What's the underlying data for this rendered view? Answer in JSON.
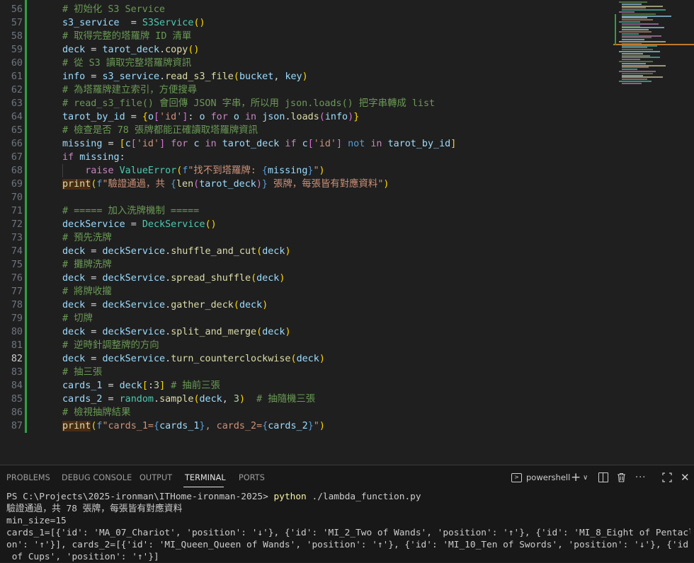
{
  "editor": {
    "active_line": "82",
    "lines": [
      {
        "num": "56",
        "segs": [
          [
            "# 初始化 S3 Service",
            "cm"
          ]
        ]
      },
      {
        "num": "57",
        "segs": [
          [
            "s3_service",
            "v"
          ],
          [
            "  = ",
            "p"
          ],
          [
            "S3Service",
            "cls"
          ],
          [
            "()",
            "br1"
          ]
        ]
      },
      {
        "num": "58",
        "segs": [
          [
            "# 取得完整的塔羅牌 ID 清單",
            "cm"
          ]
        ]
      },
      {
        "num": "59",
        "segs": [
          [
            "deck",
            "v"
          ],
          [
            " = ",
            "p"
          ],
          [
            "tarot_deck",
            "v"
          ],
          [
            ".",
            "p"
          ],
          [
            "copy",
            "fn"
          ],
          [
            "()",
            "br1"
          ]
        ]
      },
      {
        "num": "60",
        "segs": [
          [
            "# 從 S3 讀取完整塔羅牌資訊",
            "cm"
          ]
        ]
      },
      {
        "num": "61",
        "segs": [
          [
            "info",
            "v"
          ],
          [
            " = ",
            "p"
          ],
          [
            "s3_service",
            "v"
          ],
          [
            ".",
            "p"
          ],
          [
            "read_s3_file",
            "fn"
          ],
          [
            "(",
            "br1"
          ],
          [
            "bucket",
            "v"
          ],
          [
            ", ",
            "p"
          ],
          [
            "key",
            "v"
          ],
          [
            ")",
            "br1"
          ]
        ]
      },
      {
        "num": "62",
        "segs": [
          [
            "# 為塔羅牌建立索引，方便搜尋",
            "cm"
          ]
        ]
      },
      {
        "num": "63",
        "segs": [
          [
            "# read_s3_file() 會回傳 JSON 字串，所以用 json.loads() 把字串轉成 list",
            "cm"
          ]
        ]
      },
      {
        "num": "64",
        "segs": [
          [
            "tarot_by_id",
            "v"
          ],
          [
            " = ",
            "p"
          ],
          [
            "{",
            "br1"
          ],
          [
            "o",
            "v"
          ],
          [
            "[",
            "br2"
          ],
          [
            "'id'",
            "s"
          ],
          [
            "]",
            "br2"
          ],
          [
            ": ",
            "p"
          ],
          [
            "o",
            "v"
          ],
          [
            " for ",
            "kw"
          ],
          [
            "o",
            "v"
          ],
          [
            " in ",
            "kw"
          ],
          [
            "json",
            "v"
          ],
          [
            ".",
            "p"
          ],
          [
            "loads",
            "fn"
          ],
          [
            "(",
            "br2"
          ],
          [
            "info",
            "v"
          ],
          [
            ")",
            "br2"
          ],
          [
            "}",
            "br1"
          ]
        ]
      },
      {
        "num": "65",
        "segs": [
          [
            "# 檢查是否 78 張牌都能正確讀取塔羅牌資訊",
            "cm"
          ]
        ]
      },
      {
        "num": "66",
        "segs": [
          [
            "missing",
            "v"
          ],
          [
            " = ",
            "p"
          ],
          [
            "[",
            "br1"
          ],
          [
            "c",
            "v"
          ],
          [
            "[",
            "br2"
          ],
          [
            "'id'",
            "s"
          ],
          [
            "]",
            "br2"
          ],
          [
            " for ",
            "kw"
          ],
          [
            "c",
            "v"
          ],
          [
            " in ",
            "kw"
          ],
          [
            "tarot_deck",
            "v"
          ],
          [
            " if ",
            "kw"
          ],
          [
            "c",
            "v"
          ],
          [
            "[",
            "br2"
          ],
          [
            "'id'",
            "s"
          ],
          [
            "]",
            "br2"
          ],
          [
            " not ",
            "bl"
          ],
          [
            "in",
            "kw"
          ],
          [
            " ",
            "p"
          ],
          [
            "tarot_by_id",
            "v"
          ],
          [
            "]",
            "br1"
          ]
        ]
      },
      {
        "num": "67",
        "segs": [
          [
            "if ",
            "kw"
          ],
          [
            "missing",
            "v"
          ],
          [
            ":",
            "p"
          ]
        ]
      },
      {
        "num": "68",
        "segs": [
          [
            "    ",
            "p"
          ],
          [
            "raise ",
            "kw"
          ],
          [
            "ValueError",
            "cls"
          ],
          [
            "(",
            "br1"
          ],
          [
            "f",
            "bl"
          ],
          [
            "\"找不到塔羅牌: ",
            "s"
          ],
          [
            "{",
            "bl"
          ],
          [
            "missing",
            "v"
          ],
          [
            "}",
            "bl"
          ],
          [
            "\"",
            "s"
          ],
          [
            ")",
            "br1"
          ]
        ]
      },
      {
        "num": "69",
        "segs": [
          [
            "print",
            "fn hl"
          ],
          [
            "(",
            "br1"
          ],
          [
            "f",
            "bl"
          ],
          [
            "\"驗證通過，共 ",
            "s"
          ],
          [
            "{",
            "bl"
          ],
          [
            "len",
            "fn"
          ],
          [
            "(",
            "br2"
          ],
          [
            "tarot_deck",
            "v"
          ],
          [
            ")",
            "br2"
          ],
          [
            "}",
            "bl"
          ],
          [
            " 張牌，每張皆有對應資料\"",
            "s"
          ],
          [
            ")",
            "br1"
          ]
        ]
      },
      {
        "num": "70",
        "segs": []
      },
      {
        "num": "71",
        "segs": [
          [
            "# ===== 加入洗牌機制 =====",
            "cm"
          ]
        ]
      },
      {
        "num": "72",
        "segs": [
          [
            "deckService",
            "v"
          ],
          [
            " = ",
            "p"
          ],
          [
            "DeckService",
            "cls"
          ],
          [
            "()",
            "br1"
          ]
        ]
      },
      {
        "num": "73",
        "segs": [
          [
            "# 預先洗牌",
            "cm"
          ]
        ]
      },
      {
        "num": "74",
        "segs": [
          [
            "deck",
            "v"
          ],
          [
            " = ",
            "p"
          ],
          [
            "deckService",
            "v"
          ],
          [
            ".",
            "p"
          ],
          [
            "shuffle_and_cut",
            "fn"
          ],
          [
            "(",
            "br1"
          ],
          [
            "deck",
            "v"
          ],
          [
            ")",
            "br1"
          ]
        ]
      },
      {
        "num": "75",
        "segs": [
          [
            "# 攤牌洗牌",
            "cm"
          ]
        ]
      },
      {
        "num": "76",
        "segs": [
          [
            "deck",
            "v"
          ],
          [
            " = ",
            "p"
          ],
          [
            "deckService",
            "v"
          ],
          [
            ".",
            "p"
          ],
          [
            "spread_shuffle",
            "fn"
          ],
          [
            "(",
            "br1"
          ],
          [
            "deck",
            "v"
          ],
          [
            ")",
            "br1"
          ]
        ]
      },
      {
        "num": "77",
        "segs": [
          [
            "# 將牌收攏",
            "cm"
          ]
        ]
      },
      {
        "num": "78",
        "segs": [
          [
            "deck",
            "v"
          ],
          [
            " = ",
            "p"
          ],
          [
            "deckService",
            "v"
          ],
          [
            ".",
            "p"
          ],
          [
            "gather_deck",
            "fn"
          ],
          [
            "(",
            "br1"
          ],
          [
            "deck",
            "v"
          ],
          [
            ")",
            "br1"
          ]
        ]
      },
      {
        "num": "79",
        "segs": [
          [
            "# 切牌",
            "cm"
          ]
        ]
      },
      {
        "num": "80",
        "segs": [
          [
            "deck",
            "v"
          ],
          [
            " = ",
            "p"
          ],
          [
            "deckService",
            "v"
          ],
          [
            ".",
            "p"
          ],
          [
            "split_and_merge",
            "fn"
          ],
          [
            "(",
            "br1"
          ],
          [
            "deck",
            "v"
          ],
          [
            ")",
            "br1"
          ]
        ]
      },
      {
        "num": "81",
        "segs": [
          [
            "# 逆時針調整牌的方向",
            "cm"
          ]
        ]
      },
      {
        "num": "82",
        "segs": [
          [
            "deck",
            "v"
          ],
          [
            " = ",
            "p"
          ],
          [
            "deckService",
            "v"
          ],
          [
            ".",
            "p"
          ],
          [
            "turn_counterclockwise",
            "fn"
          ],
          [
            "(",
            "br1"
          ],
          [
            "deck",
            "v"
          ],
          [
            ")",
            "br1"
          ]
        ]
      },
      {
        "num": "83",
        "segs": [
          [
            "# 抽三張",
            "cm"
          ]
        ]
      },
      {
        "num": "84",
        "segs": [
          [
            "cards_1",
            "v"
          ],
          [
            " = ",
            "p"
          ],
          [
            "deck",
            "v"
          ],
          [
            "[",
            "br1"
          ],
          [
            ":",
            "p"
          ],
          [
            "3",
            "n"
          ],
          [
            "]",
            "br1"
          ],
          [
            " ",
            "p"
          ],
          [
            "# 抽前三張",
            "cm"
          ]
        ]
      },
      {
        "num": "85",
        "segs": [
          [
            "cards_2",
            "v"
          ],
          [
            " = ",
            "p"
          ],
          [
            "random",
            "cls"
          ],
          [
            ".",
            "p"
          ],
          [
            "sample",
            "fn"
          ],
          [
            "(",
            "br1"
          ],
          [
            "deck",
            "v"
          ],
          [
            ", ",
            "p"
          ],
          [
            "3",
            "n"
          ],
          [
            ")",
            "br1"
          ],
          [
            "  ",
            "p"
          ],
          [
            "# 抽隨機三張",
            "cm"
          ]
        ]
      },
      {
        "num": "86",
        "segs": [
          [
            "# 檢視抽牌結果",
            "cm"
          ]
        ]
      },
      {
        "num": "87",
        "segs": [
          [
            "print",
            "fn hl"
          ],
          [
            "(",
            "br1"
          ],
          [
            "f",
            "bl"
          ],
          [
            "\"cards_1=",
            "s"
          ],
          [
            "{",
            "bl"
          ],
          [
            "cards_1",
            "v"
          ],
          [
            "}",
            "bl"
          ],
          [
            ", cards_2=",
            "s"
          ],
          [
            "{",
            "bl"
          ],
          [
            "cards_2",
            "v"
          ],
          [
            "}",
            "bl"
          ],
          [
            "\"",
            "s"
          ],
          [
            ")",
            "br1"
          ]
        ]
      }
    ]
  },
  "panel": {
    "tabs": [
      {
        "label": "PROBLEMS",
        "name": "tab-problems",
        "active": false
      },
      {
        "label": "DEBUG CONSOLE",
        "name": "tab-debug-console",
        "active": false
      },
      {
        "label": "OUTPUT",
        "name": "tab-output",
        "active": false
      },
      {
        "label": "TERMINAL",
        "name": "tab-terminal",
        "active": true
      },
      {
        "label": "PORTS",
        "name": "tab-ports",
        "active": false
      }
    ],
    "shell_label": "powershell",
    "icons": [
      "terminal-icon",
      "add-icon",
      "chevron-down-icon",
      "split-terminal-icon",
      "trash-icon",
      "more-icon",
      "maximize-icon",
      "close-icon"
    ]
  },
  "terminal": {
    "prompt": "PS C:\\Projects\\2025-ironman\\ITHome-ironman-2025>",
    "command": "python",
    "command_args": "./lambda_function.py",
    "output": [
      "驗證通過，共 78 張牌，每張皆有對應資料",
      "min_size=15",
      "cards_1=[{'id': 'MA_07_Chariot', 'position': '↓'}, {'id': 'MI_2_Two of Wands', 'position': '↑'}, {'id': 'MI_8_Eight of Pentacles', 'positi",
      "on': '↑'}], cards_2=[{'id': 'MI_Queen_Queen of Wands', 'position': '↑'}, {'id': 'MI_10_Ten of Swords', 'position': '↓'}, {'id': 'MI_9_Nine",
      " of Cups', 'position': '↑'}]"
    ]
  },
  "colors": {
    "editor_bg": "#1f1f1f",
    "panel_bg": "#181818",
    "git_added": "#2ea043",
    "comment": "#6a9955",
    "variable": "#9cdcfe",
    "class": "#4ec9b0",
    "function": "#dcdcaa",
    "string": "#ce9178",
    "keyword": "#c586c0"
  }
}
